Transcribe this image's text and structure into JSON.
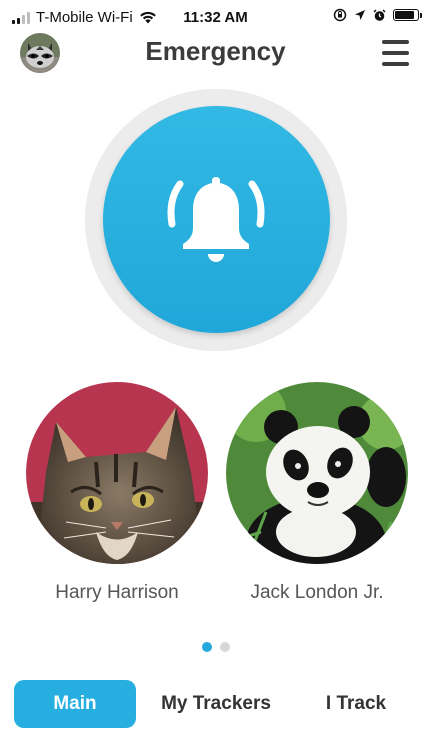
{
  "status_bar": {
    "carrier": "T-Mobile Wi-Fi",
    "time": "11:32 AM",
    "signal_bars_active": 2,
    "battery_level": 0.85
  },
  "header": {
    "title": "Emergency",
    "avatar_icon": "raccoon-avatar",
    "menu_icon": "hamburger-menu-icon"
  },
  "alarm": {
    "icon": "bell-alarm-icon",
    "color": "#27aee0"
  },
  "contacts": [
    {
      "name": "Harry Harrison",
      "photo": "cat-photo"
    },
    {
      "name": "Jack London Jr.",
      "photo": "panda-photo"
    }
  ],
  "pagination": {
    "pages": 2,
    "current": 1
  },
  "tabs": [
    {
      "label": "Main",
      "active": true
    },
    {
      "label": "My Trackers",
      "active": false
    },
    {
      "label": "I Track",
      "active": false
    }
  ]
}
